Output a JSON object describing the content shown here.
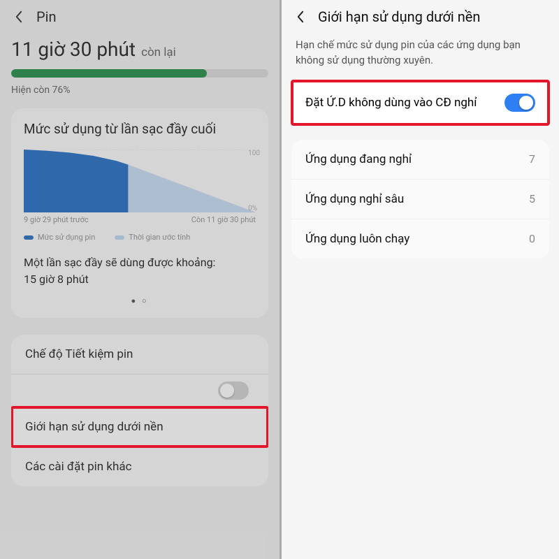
{
  "left": {
    "title": "Pin",
    "time_remaining": "11 giờ 30 phút",
    "time_suffix": "còn lại",
    "percent_text": "Hiện còn 76%",
    "progress_percent": 76,
    "card_title": "Mức sử dụng từ lần sạc đầy cuối",
    "axis_top": "100",
    "axis_bottom": "0%",
    "chart_left_label": "9 giờ 29 phút trước",
    "chart_right_label": "Còn 11 giờ 30 phút",
    "legend_actual": "Mức sử dụng pin",
    "legend_estimate": "Thời gian ước tính",
    "estimate_label": "Một lần sạc đầy sẽ dùng được khoảng:",
    "estimate_value": "15 giờ 8 phút",
    "rows": {
      "power_saving": "Chế độ Tiết kiệm pin",
      "bg_limit": "Giới hạn sử dụng dưới nền",
      "more": "Các cài đặt pin khác"
    }
  },
  "right": {
    "title": "Giới hạn sử dụng dưới nền",
    "desc": "Hạn chế mức sử dụng pin của các ứng dụng bạn không sử dụng thường xuyên.",
    "toggle_label": "Đặt Ứ.D không dùng vào CĐ nghỉ",
    "toggle_on": true,
    "items": [
      {
        "label": "Ứng dụng đang nghỉ",
        "value": "7"
      },
      {
        "label": "Ứng dụng nghỉ sâu",
        "value": "5"
      },
      {
        "label": "Ứng dụng luôn chạy",
        "value": "0"
      }
    ]
  },
  "chart_data": {
    "type": "area",
    "title": "Mức sử dụng từ lần sạc đầy cuối",
    "xlabel": "",
    "ylabel": "%",
    "ylim": [
      0,
      100
    ],
    "x_range_labels": [
      "9 giờ 29 phút trước",
      "Còn 11 giờ 30 phút"
    ],
    "series": [
      {
        "name": "Mức sử dụng pin",
        "kind": "actual",
        "x": [
          0.0,
          0.1,
          0.2,
          0.3,
          0.4,
          0.45
        ],
        "y": [
          100,
          98,
          95,
          90,
          82,
          76
        ],
        "color": "#1565c0"
      },
      {
        "name": "Thời gian ước tính",
        "kind": "estimate",
        "x": [
          0.45,
          1.0
        ],
        "y": [
          76,
          0
        ],
        "color": "#9cc5ef"
      }
    ]
  }
}
